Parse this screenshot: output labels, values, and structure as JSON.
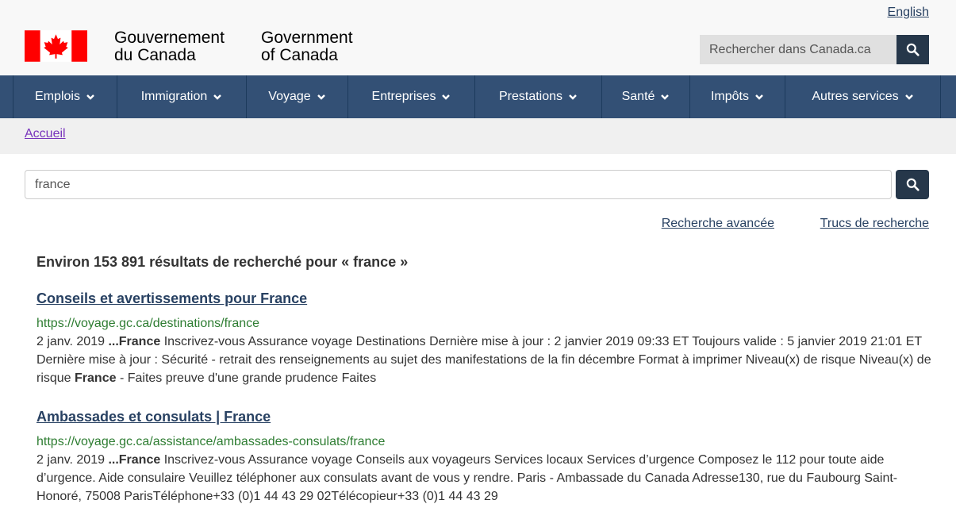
{
  "header": {
    "language_link": "English",
    "gov_fr_line1": "Gouvernement",
    "gov_fr_line2": "du Canada",
    "gov_en_line1": "Government",
    "gov_en_line2": "of Canada",
    "search_placeholder": "Rechercher dans Canada.ca",
    "flag_color": "#ff0000"
  },
  "menu": {
    "items": [
      {
        "label": "Emplois"
      },
      {
        "label": "Immigration"
      },
      {
        "label": "Voyage"
      },
      {
        "label": "Entreprises"
      },
      {
        "label": "Prestations"
      },
      {
        "label": "Santé"
      },
      {
        "label": "Impôts"
      },
      {
        "label": "Autres services"
      }
    ]
  },
  "breadcrumb": {
    "home": "Accueil"
  },
  "search": {
    "query": "france",
    "advanced_link": "Recherche avancée",
    "tips_link": "Trucs de recherche"
  },
  "summary": {
    "text": "Environ 153 891 résultats de recherché pour « france »"
  },
  "results": [
    {
      "title": "Conseils et avertissements pour France",
      "url": "https://voyage.gc.ca/destinations/france",
      "date_prefix": "2 janv. 2019 ",
      "highlight": "...France",
      "snippet_a": " Inscrivez-vous Assurance voyage Destinations Dernière mise à jour : 2 janvier 2019 09:33 ET Toujours valide : 5 janvier 2019 21:01 ET Dernière mise à jour : Sécurité - retrait des renseignements au sujet des manifestations de la fin décembre Format à imprimer Niveau(x) de risque Niveau(x) de risque ",
      "highlight2": "France",
      "snippet_b": " - Faites preuve d'une grande prudence Faites"
    },
    {
      "title": "Ambassades et consulats | France",
      "url": "https://voyage.gc.ca/assistance/ambassades-consulats/france",
      "date_prefix": "2 janv. 2019 ",
      "highlight": "...France",
      "snippet_a": " Inscrivez-vous Assurance voyage Conseils aux voyageurs Services locaux Services d’urgence Composez le 112 pour toute aide d’urgence. Aide consulaire  Veuillez téléphoner aux consulats avant de vous y rendre. Paris - Ambassade du Canada Adresse130, rue du Faubourg Saint-Honoré, 75008 ParisTéléphone+33 (0)1 44 43 29 02Télécopieur+33 (0)1 44 43 29"
    }
  ],
  "colors": {
    "menu_bg": "#335075",
    "button_bg": "#26374a",
    "link": "#284162",
    "visited_link": "#7834bc",
    "url_green": "#2e7d32"
  }
}
